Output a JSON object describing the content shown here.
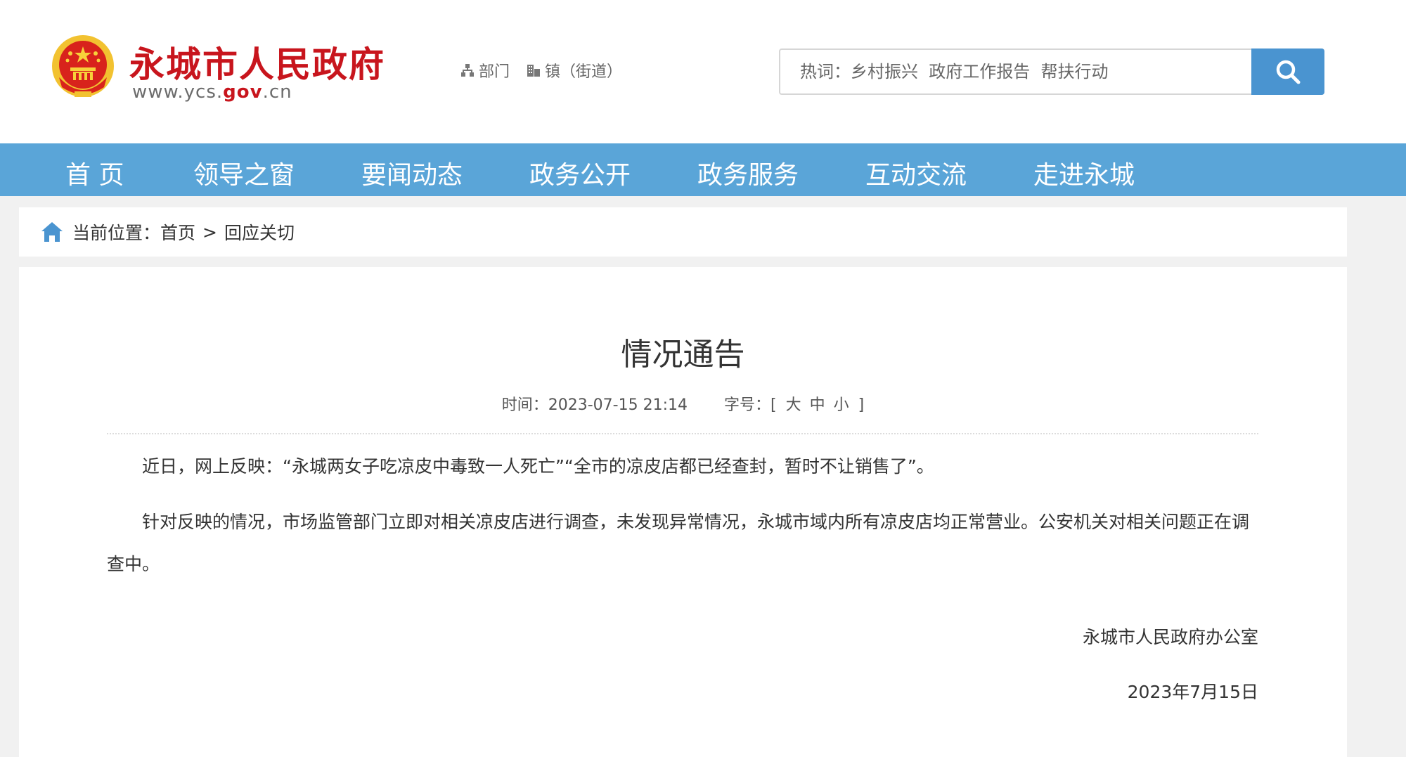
{
  "header": {
    "site_title": "永城市人民政府",
    "site_url_prefix": "www.ycs.",
    "site_url_gov": "gov",
    "site_url_suffix": ".cn",
    "logo_icon": "national-emblem",
    "quick_links": [
      {
        "label": "部门",
        "icon": "org-chart-icon"
      },
      {
        "label": "镇（街道）",
        "icon": "building-icon"
      }
    ],
    "search": {
      "placeholder": "热词：乡村振兴  政府工作报告  帮扶行动",
      "button_icon": "search-icon"
    }
  },
  "nav": {
    "items": [
      {
        "label": "首 页"
      },
      {
        "label": "领导之窗"
      },
      {
        "label": "要闻动态"
      },
      {
        "label": "政务公开"
      },
      {
        "label": "政务服务"
      },
      {
        "label": "互动交流"
      },
      {
        "label": "走进永城"
      }
    ]
  },
  "breadcrumb": {
    "prefix": "当前位置：",
    "items": [
      "首页",
      "回应关切"
    ],
    "separator": ">"
  },
  "article": {
    "title": "情况通告",
    "time_label": "时间：",
    "time_value": "2023-07-15 21:14",
    "font_label": "字号：",
    "font_open": "[",
    "font_sizes": [
      "大",
      "中",
      "小"
    ],
    "font_close": "]",
    "paragraphs": [
      "近日，网上反映：“永城两女子吃凉皮中毒致一人死亡”“全市的凉皮店都已经查封，暂时不让销售了”。",
      "针对反映的情况，市场监管部门立即对相关凉皮店进行调查，未发现异常情况，永城市域内所有凉皮店均正常营业。公安机关对相关问题正在调查中。"
    ],
    "signature": "永城市人民政府办公室",
    "date": "2023年7月15日"
  },
  "colors": {
    "brand_red": "#c8151d",
    "nav_blue": "#5aa5d8",
    "search_blue": "#4a94d0"
  }
}
